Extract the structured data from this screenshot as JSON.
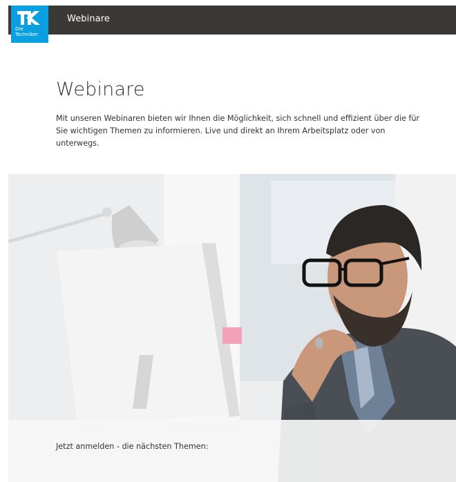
{
  "header": {
    "logo": {
      "letters": "TK",
      "line1": "Die",
      "line2": "Techniker",
      "color": "#0a9fe1"
    },
    "title": "Webinare",
    "bar_color": "#3a3936"
  },
  "main": {
    "title": "Webinare",
    "intro": "Mit unseren Webinaren bieten wir Ihnen die Möglichkeit, sich schnell und effizient über die für Sie wichtigen Themen zu informieren. Live und direkt an Ihrem Arbeitsplatz oder von unterwegs."
  },
  "hero": {
    "subject": "man-at-desk-photo"
  },
  "topics": {
    "label": "Jetzt anmelden - die nächsten Themen:"
  }
}
